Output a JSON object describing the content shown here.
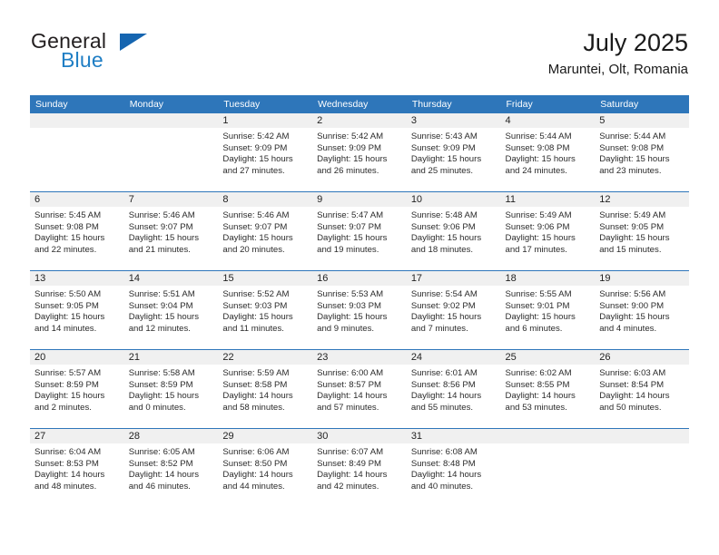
{
  "brand": {
    "line1": "General",
    "line2": "Blue",
    "triangle_color": "#1565b0",
    "line2_color": "#1f7ec4"
  },
  "header": {
    "title": "July 2025",
    "subtitle": "Maruntei, Olt, Romania"
  },
  "theme": {
    "header_blue": "#2e76ba",
    "daynum_gray": "#f0f0f0",
    "row_rule": "#2e76ba"
  },
  "weekday_headers": [
    "Sunday",
    "Monday",
    "Tuesday",
    "Wednesday",
    "Thursday",
    "Friday",
    "Saturday"
  ],
  "weeks": [
    [
      {
        "day": "",
        "sunrise": "",
        "sunset": "",
        "daylight1": "",
        "daylight2": ""
      },
      {
        "day": "",
        "sunrise": "",
        "sunset": "",
        "daylight1": "",
        "daylight2": ""
      },
      {
        "day": "1",
        "sunrise": "Sunrise: 5:42 AM",
        "sunset": "Sunset: 9:09 PM",
        "daylight1": "Daylight: 15 hours",
        "daylight2": "and 27 minutes."
      },
      {
        "day": "2",
        "sunrise": "Sunrise: 5:42 AM",
        "sunset": "Sunset: 9:09 PM",
        "daylight1": "Daylight: 15 hours",
        "daylight2": "and 26 minutes."
      },
      {
        "day": "3",
        "sunrise": "Sunrise: 5:43 AM",
        "sunset": "Sunset: 9:09 PM",
        "daylight1": "Daylight: 15 hours",
        "daylight2": "and 25 minutes."
      },
      {
        "day": "4",
        "sunrise": "Sunrise: 5:44 AM",
        "sunset": "Sunset: 9:08 PM",
        "daylight1": "Daylight: 15 hours",
        "daylight2": "and 24 minutes."
      },
      {
        "day": "5",
        "sunrise": "Sunrise: 5:44 AM",
        "sunset": "Sunset: 9:08 PM",
        "daylight1": "Daylight: 15 hours",
        "daylight2": "and 23 minutes."
      }
    ],
    [
      {
        "day": "6",
        "sunrise": "Sunrise: 5:45 AM",
        "sunset": "Sunset: 9:08 PM",
        "daylight1": "Daylight: 15 hours",
        "daylight2": "and 22 minutes."
      },
      {
        "day": "7",
        "sunrise": "Sunrise: 5:46 AM",
        "sunset": "Sunset: 9:07 PM",
        "daylight1": "Daylight: 15 hours",
        "daylight2": "and 21 minutes."
      },
      {
        "day": "8",
        "sunrise": "Sunrise: 5:46 AM",
        "sunset": "Sunset: 9:07 PM",
        "daylight1": "Daylight: 15 hours",
        "daylight2": "and 20 minutes."
      },
      {
        "day": "9",
        "sunrise": "Sunrise: 5:47 AM",
        "sunset": "Sunset: 9:07 PM",
        "daylight1": "Daylight: 15 hours",
        "daylight2": "and 19 minutes."
      },
      {
        "day": "10",
        "sunrise": "Sunrise: 5:48 AM",
        "sunset": "Sunset: 9:06 PM",
        "daylight1": "Daylight: 15 hours",
        "daylight2": "and 18 minutes."
      },
      {
        "day": "11",
        "sunrise": "Sunrise: 5:49 AM",
        "sunset": "Sunset: 9:06 PM",
        "daylight1": "Daylight: 15 hours",
        "daylight2": "and 17 minutes."
      },
      {
        "day": "12",
        "sunrise": "Sunrise: 5:49 AM",
        "sunset": "Sunset: 9:05 PM",
        "daylight1": "Daylight: 15 hours",
        "daylight2": "and 15 minutes."
      }
    ],
    [
      {
        "day": "13",
        "sunrise": "Sunrise: 5:50 AM",
        "sunset": "Sunset: 9:05 PM",
        "daylight1": "Daylight: 15 hours",
        "daylight2": "and 14 minutes."
      },
      {
        "day": "14",
        "sunrise": "Sunrise: 5:51 AM",
        "sunset": "Sunset: 9:04 PM",
        "daylight1": "Daylight: 15 hours",
        "daylight2": "and 12 minutes."
      },
      {
        "day": "15",
        "sunrise": "Sunrise: 5:52 AM",
        "sunset": "Sunset: 9:03 PM",
        "daylight1": "Daylight: 15 hours",
        "daylight2": "and 11 minutes."
      },
      {
        "day": "16",
        "sunrise": "Sunrise: 5:53 AM",
        "sunset": "Sunset: 9:03 PM",
        "daylight1": "Daylight: 15 hours",
        "daylight2": "and 9 minutes."
      },
      {
        "day": "17",
        "sunrise": "Sunrise: 5:54 AM",
        "sunset": "Sunset: 9:02 PM",
        "daylight1": "Daylight: 15 hours",
        "daylight2": "and 7 minutes."
      },
      {
        "day": "18",
        "sunrise": "Sunrise: 5:55 AM",
        "sunset": "Sunset: 9:01 PM",
        "daylight1": "Daylight: 15 hours",
        "daylight2": "and 6 minutes."
      },
      {
        "day": "19",
        "sunrise": "Sunrise: 5:56 AM",
        "sunset": "Sunset: 9:00 PM",
        "daylight1": "Daylight: 15 hours",
        "daylight2": "and 4 minutes."
      }
    ],
    [
      {
        "day": "20",
        "sunrise": "Sunrise: 5:57 AM",
        "sunset": "Sunset: 8:59 PM",
        "daylight1": "Daylight: 15 hours",
        "daylight2": "and 2 minutes."
      },
      {
        "day": "21",
        "sunrise": "Sunrise: 5:58 AM",
        "sunset": "Sunset: 8:59 PM",
        "daylight1": "Daylight: 15 hours",
        "daylight2": "and 0 minutes."
      },
      {
        "day": "22",
        "sunrise": "Sunrise: 5:59 AM",
        "sunset": "Sunset: 8:58 PM",
        "daylight1": "Daylight: 14 hours",
        "daylight2": "and 58 minutes."
      },
      {
        "day": "23",
        "sunrise": "Sunrise: 6:00 AM",
        "sunset": "Sunset: 8:57 PM",
        "daylight1": "Daylight: 14 hours",
        "daylight2": "and 57 minutes."
      },
      {
        "day": "24",
        "sunrise": "Sunrise: 6:01 AM",
        "sunset": "Sunset: 8:56 PM",
        "daylight1": "Daylight: 14 hours",
        "daylight2": "and 55 minutes."
      },
      {
        "day": "25",
        "sunrise": "Sunrise: 6:02 AM",
        "sunset": "Sunset: 8:55 PM",
        "daylight1": "Daylight: 14 hours",
        "daylight2": "and 53 minutes."
      },
      {
        "day": "26",
        "sunrise": "Sunrise: 6:03 AM",
        "sunset": "Sunset: 8:54 PM",
        "daylight1": "Daylight: 14 hours",
        "daylight2": "and 50 minutes."
      }
    ],
    [
      {
        "day": "27",
        "sunrise": "Sunrise: 6:04 AM",
        "sunset": "Sunset: 8:53 PM",
        "daylight1": "Daylight: 14 hours",
        "daylight2": "and 48 minutes."
      },
      {
        "day": "28",
        "sunrise": "Sunrise: 6:05 AM",
        "sunset": "Sunset: 8:52 PM",
        "daylight1": "Daylight: 14 hours",
        "daylight2": "and 46 minutes."
      },
      {
        "day": "29",
        "sunrise": "Sunrise: 6:06 AM",
        "sunset": "Sunset: 8:50 PM",
        "daylight1": "Daylight: 14 hours",
        "daylight2": "and 44 minutes."
      },
      {
        "day": "30",
        "sunrise": "Sunrise: 6:07 AM",
        "sunset": "Sunset: 8:49 PM",
        "daylight1": "Daylight: 14 hours",
        "daylight2": "and 42 minutes."
      },
      {
        "day": "31",
        "sunrise": "Sunrise: 6:08 AM",
        "sunset": "Sunset: 8:48 PM",
        "daylight1": "Daylight: 14 hours",
        "daylight2": "and 40 minutes."
      },
      {
        "day": "",
        "sunrise": "",
        "sunset": "",
        "daylight1": "",
        "daylight2": ""
      },
      {
        "day": "",
        "sunrise": "",
        "sunset": "",
        "daylight1": "",
        "daylight2": ""
      }
    ]
  ]
}
